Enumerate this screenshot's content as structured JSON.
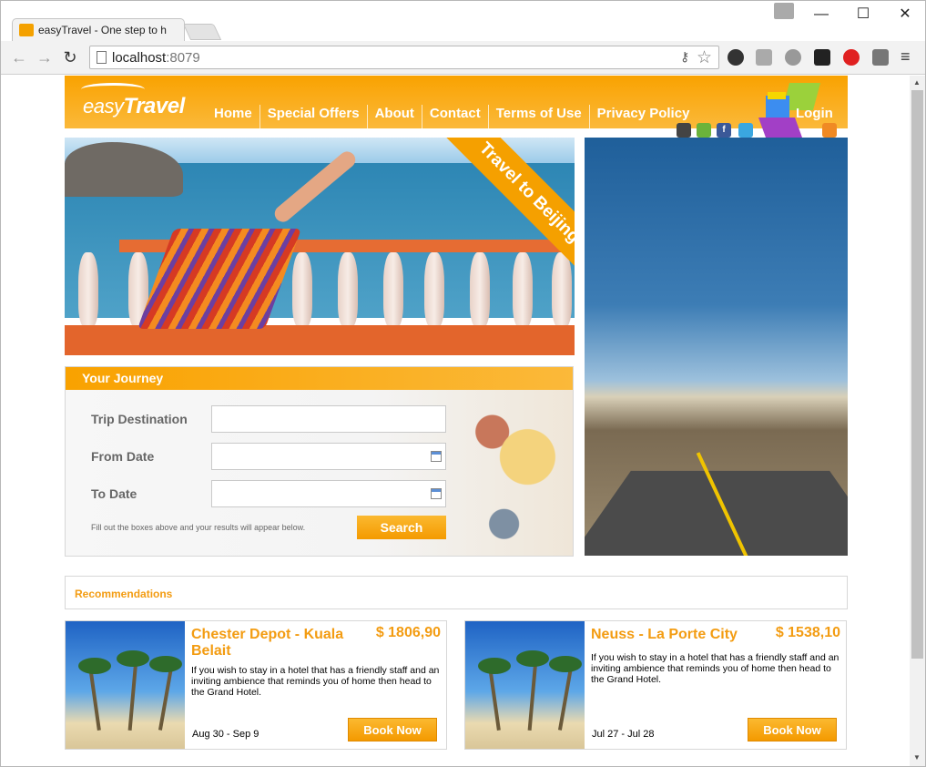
{
  "browser": {
    "tab_title": "easyTravel - One step to h",
    "url_host": "localhost",
    "url_port": ":8079",
    "min_label": "—",
    "max_label": "☐",
    "close_label": "✕"
  },
  "site": {
    "logo_easy": "easy",
    "logo_travel": "Travel",
    "nav": [
      "Home",
      "Special Offers",
      "About",
      "Contact",
      "Terms of Use",
      "Privacy Policy"
    ],
    "login_label": "Login",
    "social_icons": [
      "apple-icon",
      "android-icon",
      "facebook-icon",
      "twitter-icon",
      "rss-icon"
    ],
    "hero_banner": "Travel to Beijing"
  },
  "journey": {
    "title": "Your Journey",
    "destination_label": "Trip Destination",
    "destination_value": "",
    "from_label": "From Date",
    "from_value": "",
    "to_label": "To Date",
    "to_value": "",
    "note": "Fill out the boxes above and your results will appear below.",
    "search_label": "Search"
  },
  "recommendations": {
    "title": "Recommendations",
    "cards": [
      {
        "title": "Chester Depot - Kuala Belait",
        "price": "$ 1806,90",
        "description": "If you wish to stay in a hotel that has a friendly staff and an inviting ambience that reminds you of home then head to the Grand Hotel.",
        "dates": "Aug 30 - Sep 9",
        "book_label": "Book Now"
      },
      {
        "title": "Neuss - La Porte City",
        "price": "$ 1538,10",
        "description": "If you wish to stay in a hotel that has a friendly staff and an inviting ambience that reminds you of home then head to the Grand Hotel.",
        "dates": "Jul 27 - Jul 28",
        "book_label": "Book Now"
      }
    ]
  },
  "colors": {
    "brand_orange": "#f9a200",
    "accent_text": "#f39c12"
  }
}
